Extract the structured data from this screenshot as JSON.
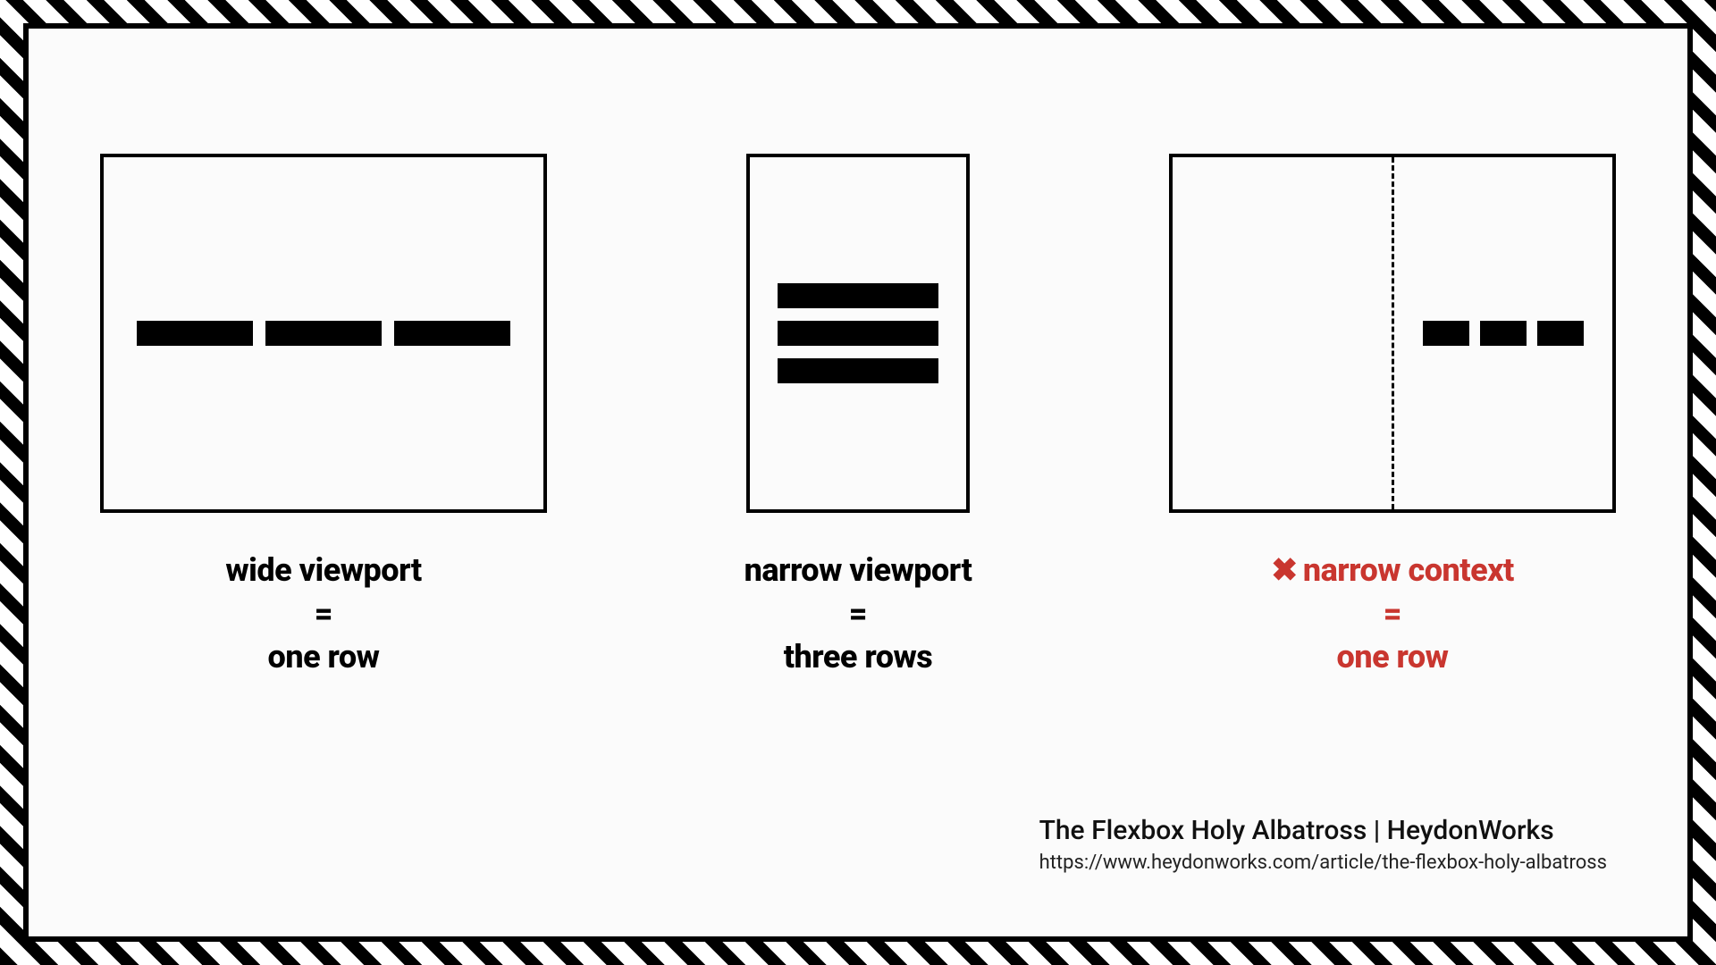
{
  "panels": {
    "wide": {
      "line1": "wide viewport",
      "eq": "=",
      "line2": "one row"
    },
    "narrow": {
      "line1": "narrow viewport",
      "eq": "=",
      "line2": "three rows"
    },
    "context": {
      "icon": "✖",
      "line1": "narrow context",
      "eq": "=",
      "line2": "one row"
    }
  },
  "attribution": {
    "title": "The Flexbox Holy Albatross | HeydonWorks",
    "url": "https://www.heydonworks.com/article/the-flexbox-holy-albatross"
  }
}
